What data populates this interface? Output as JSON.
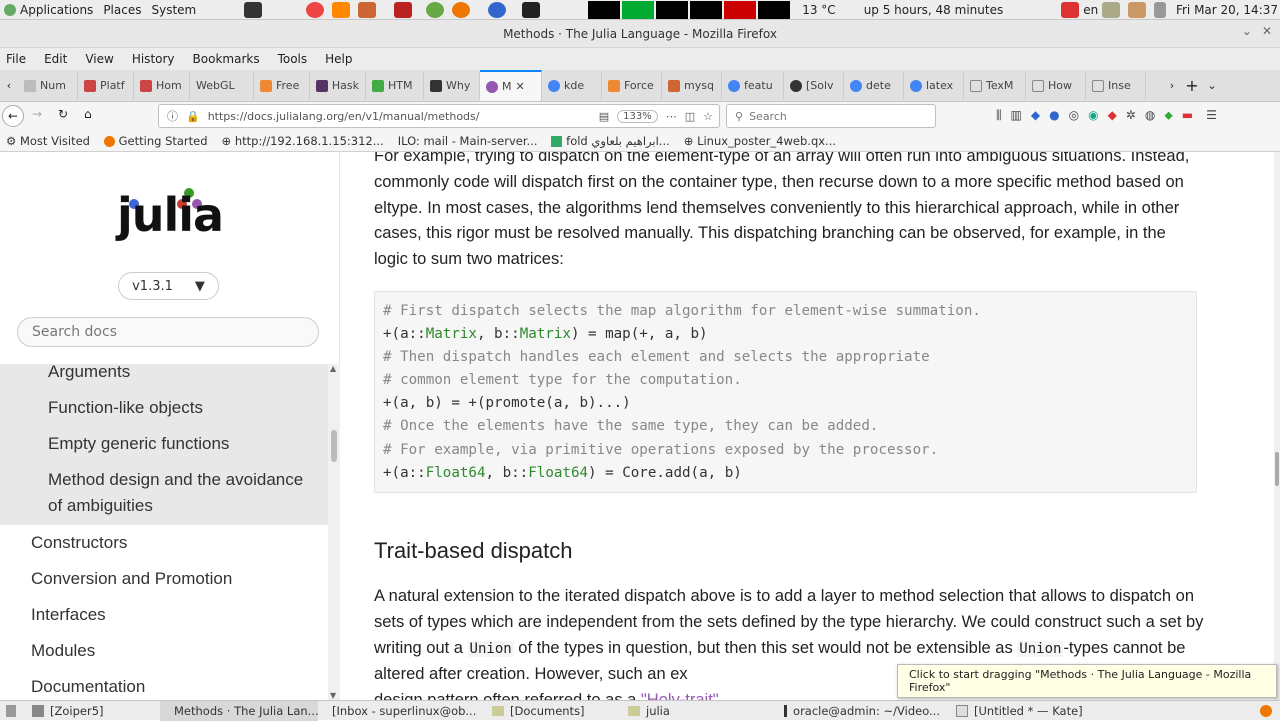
{
  "topbar": {
    "apps": "Applications",
    "places": "Places",
    "system": "System",
    "temp": "13 °C",
    "uptime": "up 5 hours, 48 minutes",
    "lang": "en",
    "clock": "Fri Mar 20, 14:37"
  },
  "window": {
    "title": "Methods · The Julia Language - Mozilla Firefox"
  },
  "menubar": [
    "File",
    "Edit",
    "View",
    "History",
    "Bookmarks",
    "Tools",
    "Help"
  ],
  "tabs": [
    "Num",
    "Platf",
    "Hom",
    "WebGL",
    "Free",
    "Hask",
    "HTM",
    "Why",
    "M",
    "kde",
    "Force",
    "mysq",
    "featu",
    "[Solv",
    "dete",
    "latex",
    "TexM",
    "How",
    "Inse"
  ],
  "nav": {
    "url": "https://docs.julialang.org/en/v1/manual/methods/",
    "zoom": "133%",
    "search_placeholder": "Search"
  },
  "bookmarks": [
    "Most Visited",
    "Getting Started",
    "http://192.168.1.15:312...",
    "ILO: mail - Main-server...",
    "fold ابراهيم بلعاوي...",
    "Linux_poster_4web.qx..."
  ],
  "sidebar": {
    "logo": "julia",
    "version": "v1.3.1",
    "search_placeholder": "Search docs",
    "sub_items": [
      "Arguments",
      "Function-like objects",
      "Empty generic functions",
      "Method design and the avoidance of ambiguities"
    ],
    "top_items": [
      "Constructors",
      "Conversion and Promotion",
      "Interfaces",
      "Modules",
      "Documentation"
    ]
  },
  "content": {
    "para1": "For example, trying to dispatch on the element-type of an array will often run into ambiguous situations. Instead, commonly code will dispatch first on the container type, then recurse down to a more specific method based on eltype. In most cases, the algorithms lend themselves conveniently to this hierarchical approach, while in other cases, this rigor must be resolved manually. This dispatching branching can be observed, for example, in the logic to sum two matrices:",
    "code": {
      "c1": "# First dispatch selects the map algorithm for element-wise summation.",
      "l2a": "+(a::",
      "l2t1": "Matrix",
      "l2b": ", b::",
      "l2t2": "Matrix",
      "l2c": ") = map(+, a, b)",
      "c3": "# Then dispatch handles each element and selects the appropriate",
      "c4": "# common element type for the computation.",
      "l5": "+(a, b) = +(promote(a, b)...)",
      "c6": "# Once the elements have the same type, they can be added.",
      "c7": "# For example, via primitive operations exposed by the processor.",
      "l8a": "+(a::",
      "l8t1": "Float64",
      "l8b": ", b::",
      "l8t2": "Float64",
      "l8c": ") = Core.add(a, b)"
    },
    "heading": "Trait-based dispatch",
    "p2a": "A natural extension to the iterated dispatch above is to add a layer to method selection that allows to dispatch on sets of types which are independent from the sets defined by the type hierarchy. We could construct such a set by writing out a ",
    "p2code1": "Union",
    "p2b": " of the types in question, but then this set would not be extensible as ",
    "p2code2": "Union",
    "p2c": "-types cannot be altered after creation. However, such an ex",
    "p3a": "design pattern often referred to as a ",
    "p3link": "\"Holy-trait\""
  },
  "tooltip": "Click to start dragging \"Methods · The Julia Language - Mozilla Firefox\"",
  "taskbar": [
    "[Zoiper5]",
    "Methods · The Julia Lan...",
    "[Inbox - superlinux@ob...",
    "[Documents]",
    "julia",
    "oracle@admin: ~/Video...",
    "[Untitled * — Kate]"
  ]
}
